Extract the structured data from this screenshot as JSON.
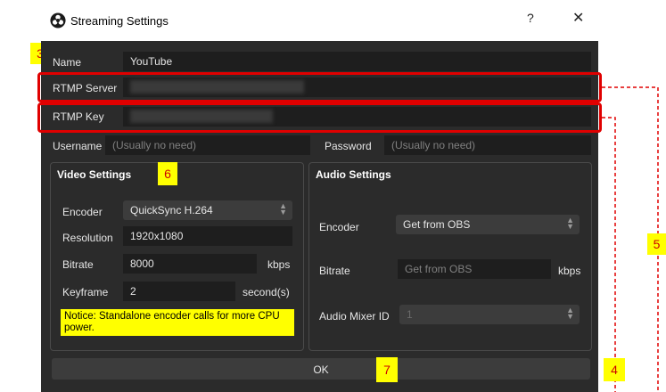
{
  "dialog": {
    "title": "Streaming Settings",
    "help_glyph": "?",
    "close_glyph": "✕"
  },
  "form": {
    "name_label": "Name",
    "name_value": "YouTube",
    "server_label": "RTMP Server",
    "key_label": "RTMP Key",
    "username_label": "Username",
    "username_placeholder": "(Usually no need)",
    "password_label": "Password",
    "password_placeholder": "(Usually no need)"
  },
  "video": {
    "title": "Video Settings",
    "encoder_label": "Encoder",
    "encoder_value": "QuickSync H.264",
    "resolution_label": "Resolution",
    "resolution_value": "1920x1080",
    "bitrate_label": "Bitrate",
    "bitrate_value": "8000",
    "bitrate_unit": "kbps",
    "keyframe_label": "Keyframe",
    "keyframe_value": "2",
    "keyframe_unit": "second(s)",
    "notice": "Notice: Standalone encoder calls for more CPU power."
  },
  "audio": {
    "title": "Audio Settings",
    "encoder_label": "Encoder",
    "encoder_value": "Get from OBS",
    "bitrate_label": "Bitrate",
    "bitrate_placeholder": "Get from OBS",
    "bitrate_unit": "kbps",
    "mixer_label": "Audio Mixer ID",
    "mixer_value": "1"
  },
  "ok_label": "OK",
  "annotations": {
    "a3": "3",
    "a4": "4",
    "a5": "5",
    "a6": "6",
    "a7": "7",
    "highlight_color": "#e00000",
    "badge_color": "#ffff00"
  }
}
